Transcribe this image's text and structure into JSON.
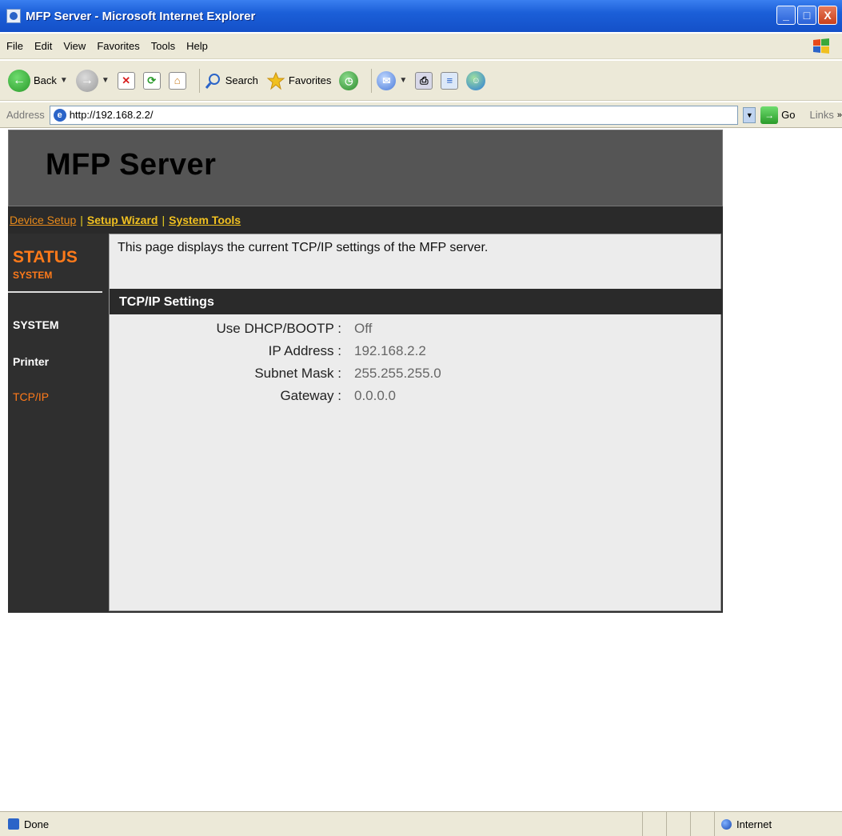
{
  "window": {
    "title": "MFP Server - Microsoft Internet Explorer",
    "minimize": "_",
    "maximize": "□",
    "close": "X"
  },
  "menu": [
    "File",
    "Edit",
    "View",
    "Favorites",
    "Tools",
    "Help"
  ],
  "toolbar": {
    "back_label": "Back",
    "search_label": "Search",
    "favorites_label": "Favorites"
  },
  "address": {
    "label": "Address",
    "url": "http://192.168.2.2/",
    "go_label": "Go",
    "links_label": "Links"
  },
  "page": {
    "title": "MFP Server",
    "nav": {
      "device_setup": "Device Setup",
      "separator": "|",
      "setup_wizard": "Setup Wizard",
      "system_tools": "System Tools"
    },
    "sidebar": {
      "heading": "STATUS",
      "subheading": "SYSTEM",
      "items": [
        "SYSTEM",
        "Printer",
        "TCP/IP"
      ],
      "active_item": "TCP/IP"
    },
    "intro": "This page displays the current TCP/IP settings of the MFP server.",
    "section_title": "TCP/IP Settings",
    "settings": [
      {
        "label": "Use DHCP/BOOTP :",
        "value": "Off"
      },
      {
        "label": "IP Address :",
        "value": "192.168.2.2"
      },
      {
        "label": "Subnet Mask :",
        "value": "255.255.255.0"
      },
      {
        "label": "Gateway :",
        "value": "0.0.0.0"
      }
    ]
  },
  "status": {
    "text": "Done",
    "zone": "Internet"
  },
  "colors": {
    "accent_orange": "#ff7a1a",
    "nav_yellow": "#f0c020",
    "title_bar": "#1b5fd8"
  }
}
